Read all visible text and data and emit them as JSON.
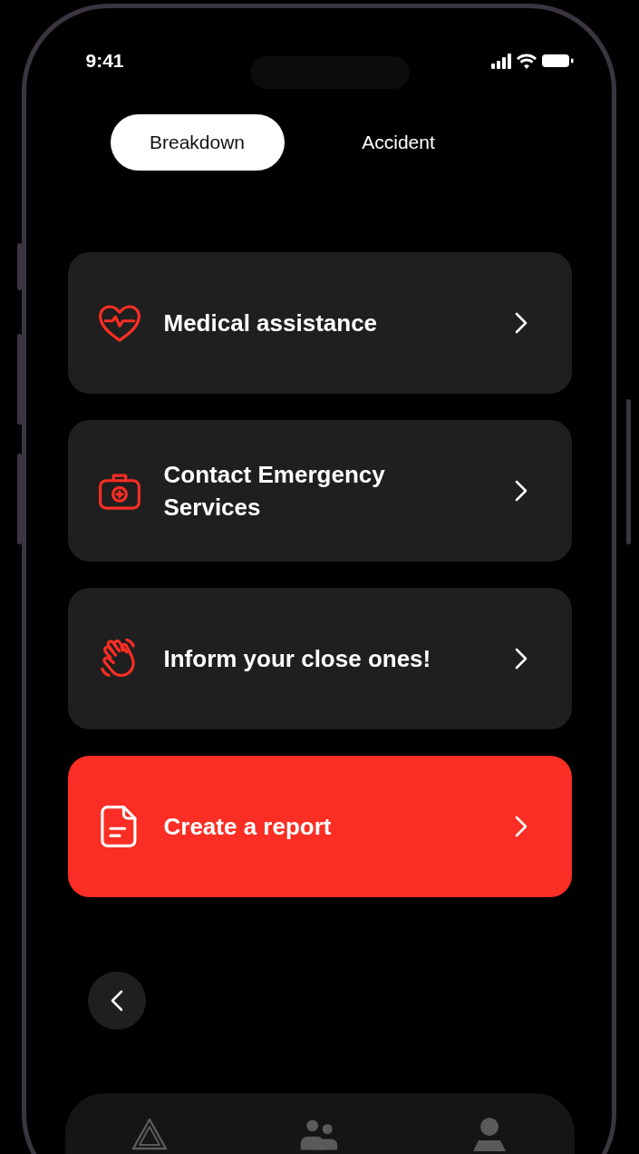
{
  "status_bar": {
    "time": "9:41"
  },
  "tabs": [
    {
      "label": "Breakdown",
      "selected": true
    },
    {
      "label": "Accident",
      "selected": false
    }
  ],
  "actions": [
    {
      "kind": "heart",
      "label": "Medical assistance",
      "highlighted": false
    },
    {
      "kind": "kit",
      "label": "Contact Emergency Services",
      "highlighted": false
    },
    {
      "kind": "hand",
      "label": "Inform your close ones!",
      "highlighted": false
    },
    {
      "kind": "document",
      "label": "Create a report",
      "highlighted": true
    }
  ],
  "nav": [
    {
      "kind": "warning"
    },
    {
      "kind": "people"
    },
    {
      "kind": "person"
    }
  ]
}
